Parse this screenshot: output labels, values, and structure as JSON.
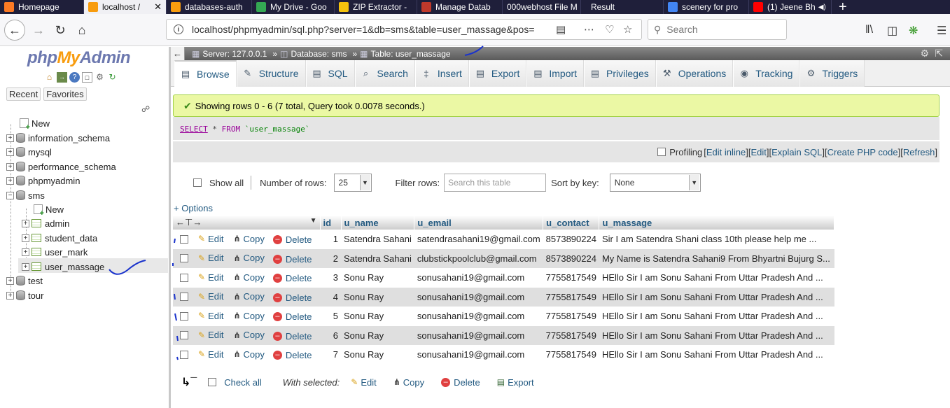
{
  "browser_tabs": [
    {
      "title": "Homepage",
      "icon": "xampp-icon",
      "color": "#fb7a24"
    },
    {
      "title": "localhost /",
      "icon": "pma-icon",
      "color": "#f89c0e",
      "active": true
    },
    {
      "title": "databases-auth",
      "icon": "pma-icon",
      "color": "#f89c0e"
    },
    {
      "title": "My Drive - Goo",
      "icon": "drive-icon",
      "color": "#34a853"
    },
    {
      "title": "ZIP Extractor -",
      "icon": "zip-icon",
      "color": "#f4c20d"
    },
    {
      "title": "Manage Datab",
      "icon": "webhost-icon",
      "color": "#c0392b"
    },
    {
      "title": "000webhost File M",
      "icon": "none",
      "color": ""
    },
    {
      "title": "Result",
      "icon": "none",
      "color": ""
    },
    {
      "title": "scenery for pro",
      "icon": "google-icon",
      "color": "#4285f4"
    },
    {
      "title": "(1) Jeene Bh",
      "icon": "youtube-icon",
      "color": "#ff0000"
    }
  ],
  "url": "localhost/phpmyadmin/sql.php?server=1&db=sms&table=user_massage&pos=",
  "search_placeholder": "Search",
  "sidebar": {
    "logo_php": "php",
    "logo_my": "My",
    "logo_admin": "Admin",
    "recent": "Recent",
    "favorites": "Favorites",
    "databases": [
      "New",
      "information_schema",
      "mysql",
      "performance_schema",
      "phpmyadmin",
      "sms",
      "test",
      "tour"
    ],
    "sms_children": [
      "New",
      "admin",
      "student_data",
      "user_mark",
      "user_massage"
    ]
  },
  "breadcrumb": {
    "server": "Server: 127.0.0.1",
    "database": "Database: sms",
    "table": "Table: user_massage"
  },
  "tabs": [
    "Browse",
    "Structure",
    "SQL",
    "Search",
    "Insert",
    "Export",
    "Import",
    "Privileges",
    "Operations",
    "Tracking",
    "Triggers"
  ],
  "success_message": "Showing rows 0 - 6 (7 total, Query took 0.0078 seconds.)",
  "sql": {
    "select": "SELECT",
    "star": "*",
    "from": "FROM",
    "table": "`user_massage`"
  },
  "profiling": {
    "label": "Profiling",
    "links": [
      "Edit inline",
      "Edit",
      "Explain SQL",
      "Create PHP code",
      "Refresh"
    ]
  },
  "nav": {
    "show_all": "Show all",
    "number_of_rows_label": "Number of rows:",
    "number_of_rows": "25",
    "filter_label": "Filter rows:",
    "filter_placeholder": "Search this table",
    "sort_label": "Sort by key:",
    "sort_value": "None"
  },
  "options": "+ Options",
  "columns": [
    "id",
    "u_name",
    "u_email",
    "u_contact",
    "u_massage"
  ],
  "actions": {
    "edit": "Edit",
    "copy": "Copy",
    "delete": "Delete"
  },
  "rows": [
    {
      "id": "1",
      "u_name": "Satendra Sahani",
      "u_email": "satendrasahani19@gmail.com",
      "u_contact": "8573890224",
      "u_massage": "Sir I am Satendra Shani class 10th please help me ..."
    },
    {
      "id": "2",
      "u_name": "Satendra Sahani",
      "u_email": "clubstickpoolclub@gmail.com",
      "u_contact": "8573890224",
      "u_massage": "My Name is Satendra Sahani9 From Bhyartni Bujurg S..."
    },
    {
      "id": "3",
      "u_name": "Sonu Ray",
      "u_email": "sonusahani19@gmail.com",
      "u_contact": "7755817549",
      "u_massage": "HEllo Sir I am Sonu Sahani From Uttar Pradesh And ..."
    },
    {
      "id": "4",
      "u_name": "Sonu Ray",
      "u_email": "sonusahani19@gmail.com",
      "u_contact": "7755817549",
      "u_massage": "HEllo Sir I am Sonu Sahani From Uttar Pradesh And ..."
    },
    {
      "id": "5",
      "u_name": "Sonu Ray",
      "u_email": "sonusahani19@gmail.com",
      "u_contact": "7755817549",
      "u_massage": "HEllo Sir I am Sonu Sahani From Uttar Pradesh And ..."
    },
    {
      "id": "6",
      "u_name": "Sonu Ray",
      "u_email": "sonusahani19@gmail.com",
      "u_contact": "7755817549",
      "u_massage": "HEllo Sir I am Sonu Sahani From Uttar Pradesh And ..."
    },
    {
      "id": "7",
      "u_name": "Sonu Ray",
      "u_email": "sonusahani19@gmail.com",
      "u_contact": "7755817549",
      "u_massage": "HEllo Sir I am Sonu Sahani From Uttar Pradesh And ..."
    }
  ],
  "bottom": {
    "check_all": "Check all",
    "with_selected": "With selected:",
    "edit": "Edit",
    "copy": "Copy",
    "delete": "Delete",
    "export": "Export"
  }
}
